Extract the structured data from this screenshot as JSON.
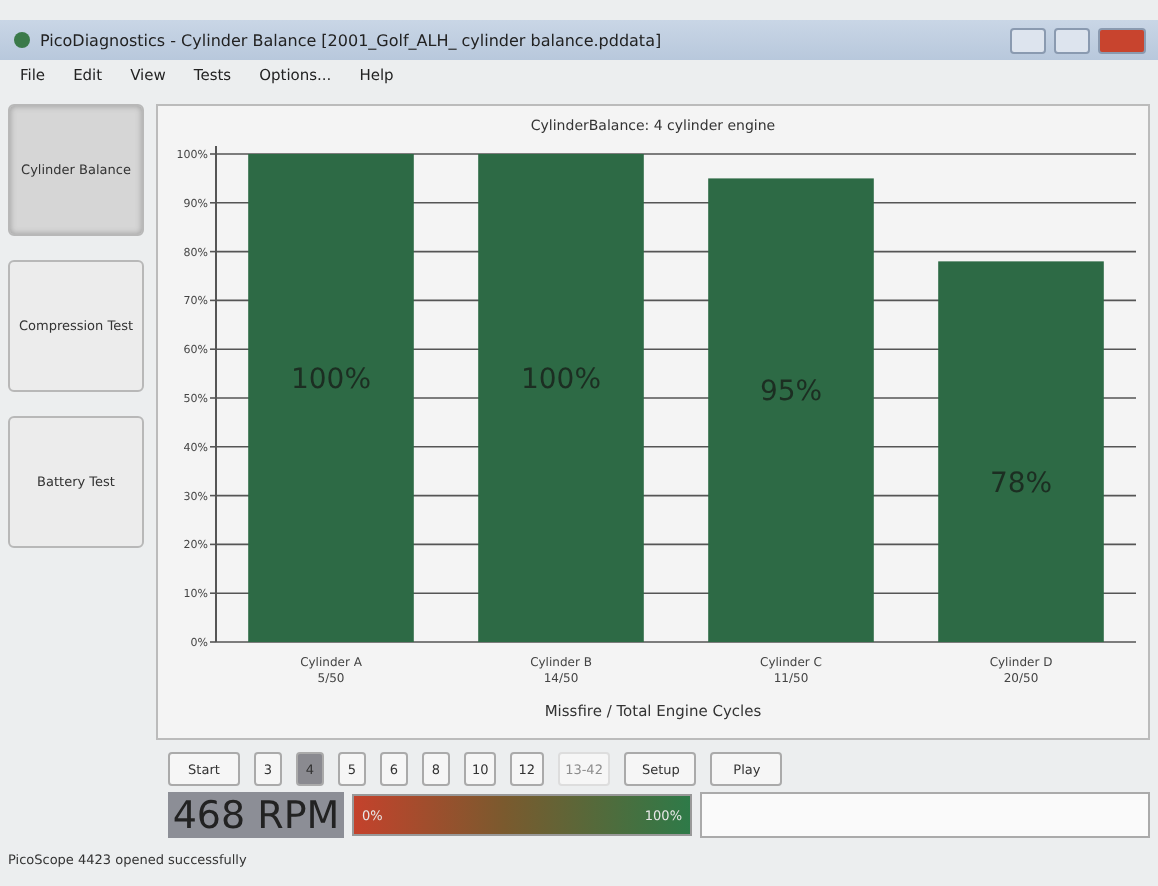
{
  "window": {
    "title": "PicoDiagnostics - Cylinder Balance [2001_Golf_ALH_ cylinder balance.pddata]"
  },
  "menu": [
    "File",
    "Edit",
    "View",
    "Tests",
    "Options...",
    "Help"
  ],
  "sidebar": [
    {
      "label": "Cylinder Balance",
      "selected": true
    },
    {
      "label": "Compression Test",
      "selected": false
    },
    {
      "label": "Battery Test",
      "selected": false
    }
  ],
  "chart": {
    "counts": [
      "5/50",
      "14/50",
      "11/50",
      "20/50"
    ],
    "chart_data": {
      "type": "bar",
      "title": "CylinderBalance: 4 cylinder engine",
      "xlabel": "Missfire / Total Engine Cycles",
      "categories": [
        "Cylinder A",
        "Cylinder B",
        "Cylinder C",
        "Cylinder D"
      ],
      "series": [
        {
          "color": "#2d6a45",
          "values": [
            100,
            100,
            95,
            78
          ]
        }
      ],
      "ylim": [
        0,
        100
      ],
      "yticks": [
        {
          "value": 0,
          "label": "0%"
        },
        {
          "value": 10,
          "label": "10%"
        },
        {
          "value": 20,
          "label": "20%"
        },
        {
          "value": 30,
          "label": "30%"
        },
        {
          "value": 40,
          "label": "40%"
        },
        {
          "value": 50,
          "label": "50%"
        },
        {
          "value": 60,
          "label": "60%"
        },
        {
          "value": 70,
          "label": "70%"
        },
        {
          "value": 80,
          "label": "80%"
        },
        {
          "value": 90,
          "label": "90%"
        },
        {
          "value": 100,
          "label": "100%"
        }
      ],
      "grid": true,
      "value_labels": [
        "100%",
        "100%",
        "95%",
        "78%"
      ]
    }
  },
  "controls": [
    {
      "label": "Start",
      "kind": "action",
      "selected": false,
      "disabled": false
    },
    {
      "label": "3",
      "kind": "count",
      "selected": false,
      "disabled": false
    },
    {
      "label": "4",
      "kind": "count",
      "selected": true,
      "disabled": false
    },
    {
      "label": "5",
      "kind": "count",
      "selected": false,
      "disabled": false
    },
    {
      "label": "6",
      "kind": "count",
      "selected": false,
      "disabled": false
    },
    {
      "label": "8",
      "kind": "count",
      "selected": false,
      "disabled": false
    },
    {
      "label": "10",
      "kind": "count",
      "selected": false,
      "disabled": false
    },
    {
      "label": "12",
      "kind": "count",
      "selected": false,
      "disabled": false
    },
    {
      "label": "13-42",
      "kind": "count",
      "selected": false,
      "disabled": true
    },
    {
      "label": "Setup",
      "kind": "action",
      "selected": false,
      "disabled": false
    },
    {
      "label": "Play",
      "kind": "action",
      "selected": false,
      "disabled": false
    }
  ],
  "rpm": "468 RPM",
  "meter": {
    "min_label": "0%",
    "max_label": "100%"
  },
  "status_bar": "PicoScope 4423 opened successfully"
}
